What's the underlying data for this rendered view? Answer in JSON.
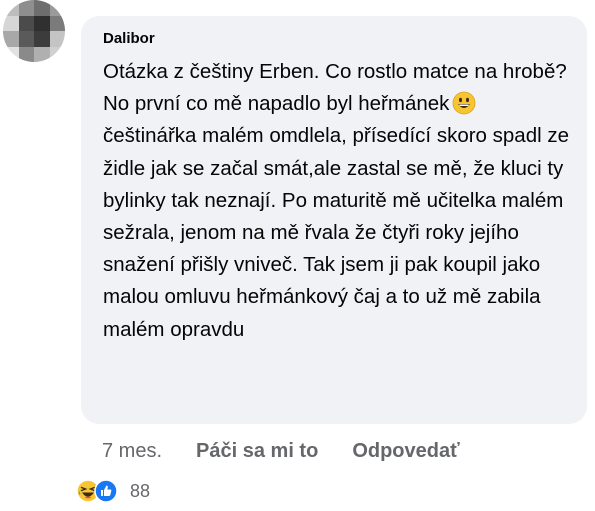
{
  "comment": {
    "author": "Dalibor",
    "text": {
      "before_emoji": "Otázka z češtiny Erben. Co rostlo matce na hrobě? No první co mě napadlo byl heřmánek",
      "after_emoji": " češtinářka malém omdlela, přísedící skoro spadl ze židle jak se začal smát,ale zastal se mě, že kluci ty bylinky tak neznají. Po maturitě mě učitelka malém sežrala, jenom na mě řvala že čtyři roky jejího snažení přišly vniveč. Tak jsem ji pak koupil jako malou omluvu heřmánkový čaj a to už mě zabila malém opravdu"
    },
    "inline_emoji_icon": "grinning-face-icon"
  },
  "actions": {
    "time": "7 mes.",
    "like_label": "Páči sa mi to",
    "reply_label": "Odpovedať"
  },
  "reactions": {
    "icons": [
      "laughing-face-icon",
      "like-thumb-icon"
    ],
    "count": "88"
  },
  "colors": {
    "bubble": "#f0f2f5",
    "text": "#050505",
    "secondary": "#65676b",
    "like_blue": "#1877f2",
    "emoji_yellow": "#f7c531"
  }
}
